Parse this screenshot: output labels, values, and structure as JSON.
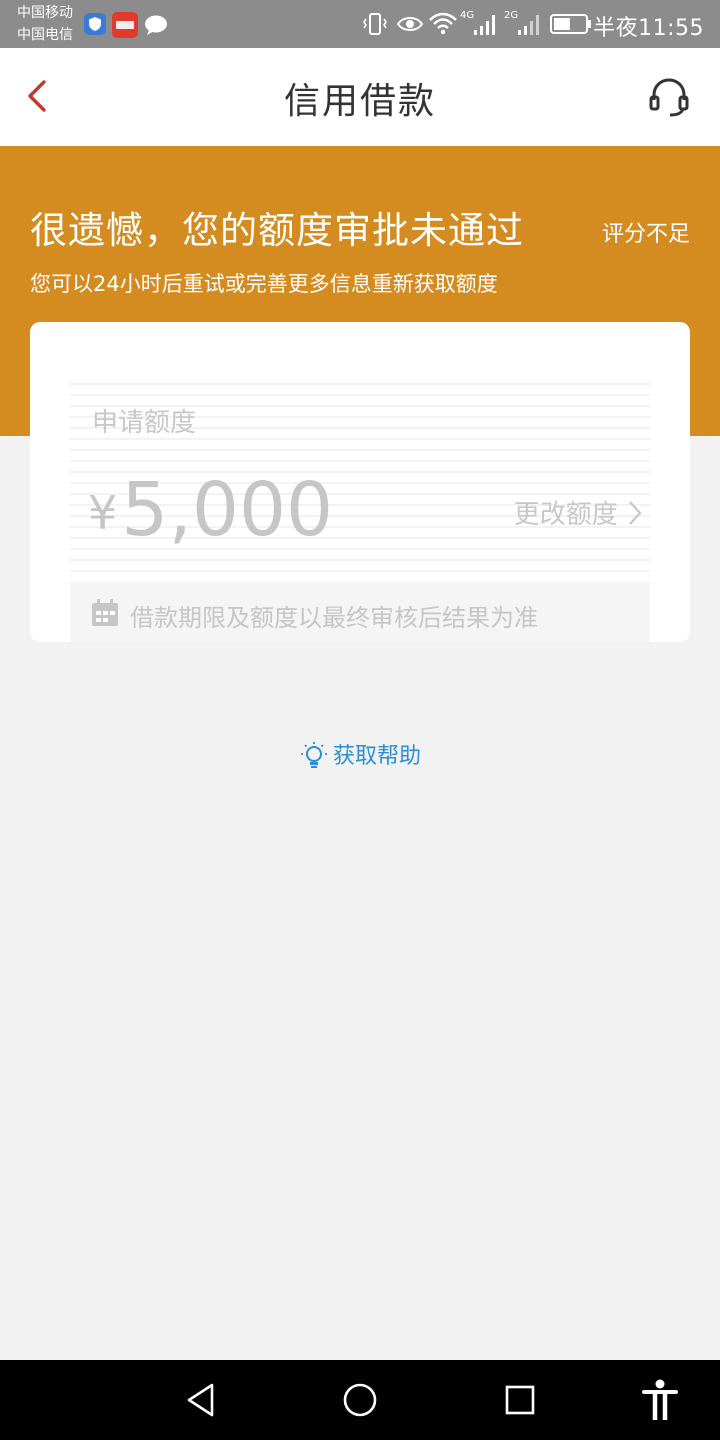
{
  "status_bar": {
    "carrier_1": "中国移动",
    "carrier_2": "中国电信",
    "network_1": "4G",
    "network_2": "2G",
    "time": "半夜11:55"
  },
  "header": {
    "title": "信用借款"
  },
  "banner": {
    "headline": "很遗憾，您的额度审批未通过",
    "reason": "评分不足",
    "subtitle": "您可以24小时后重试或完善更多信息重新获取额度",
    "background_color": "#d48c20"
  },
  "card": {
    "amount_label": "申请额度",
    "currency": "¥",
    "amount": "5,000",
    "change_label": "更改额度",
    "note": "借款期限及额度以最终审核后结果为准"
  },
  "help": {
    "label": "获取帮助",
    "icon": "lightbulb-icon",
    "color": "#2b8fd6"
  },
  "colors": {
    "back_arrow": "#c0392b",
    "page_background": "#f2f2f2"
  }
}
